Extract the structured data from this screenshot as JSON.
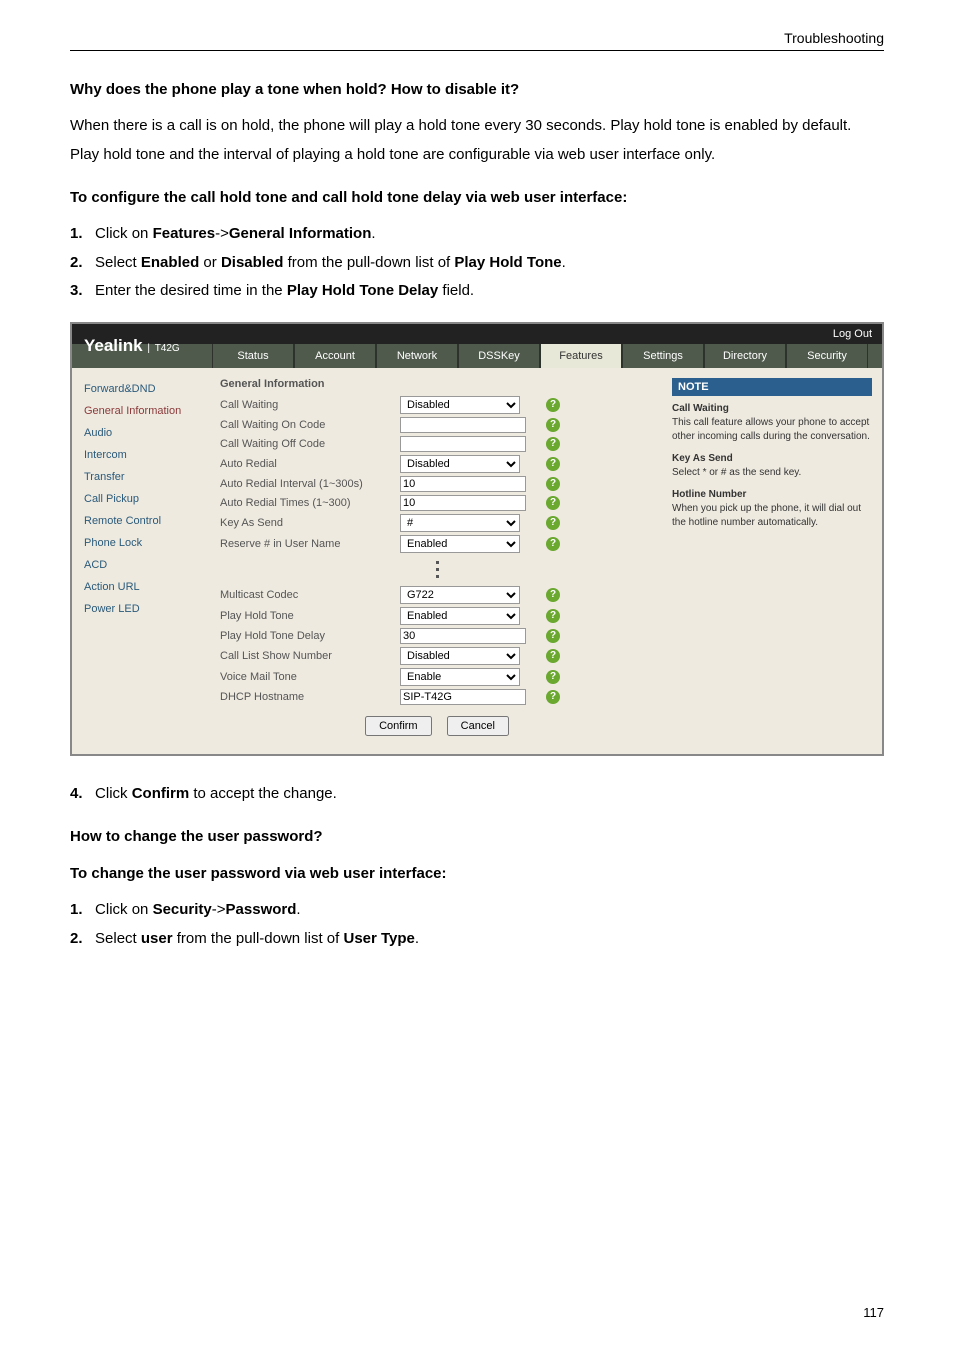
{
  "header_title": "Troubleshooting",
  "q1_heading": "Why does the phone play a tone when hold? How to disable it?",
  "q1_body": "When there is a call is on hold, the phone will play a hold tone every 30 seconds. Play hold tone is enabled by default. Play hold tone and the interval of playing a hold tone are configurable via web user interface only.",
  "q1_proc": "To configure the call hold tone and call hold tone delay via web user interface:",
  "q1_step1_num": "1.",
  "q1_step1_a": "Click on ",
  "q1_step1_b": "Features",
  "q1_step1_c": "->",
  "q1_step1_d": "General Information",
  "q1_step1_e": ".",
  "q1_step2_num": "2.",
  "q1_step2_a": "Select ",
  "q1_step2_b": "Enabled",
  "q1_step2_c": " or ",
  "q1_step2_d": "Disabled",
  "q1_step2_e": " from the pull-down list of ",
  "q1_step2_f": "Play Hold Tone",
  "q1_step2_g": ".",
  "q1_step3_num": "3.",
  "q1_step3_a": "Enter the desired time in the ",
  "q1_step3_b": "Play Hold Tone Delay",
  "q1_step3_c": " field.",
  "q1_step4_num": "4.",
  "q1_step4_a": "Click ",
  "q1_step4_b": "Confirm",
  "q1_step4_c": " to accept the change.",
  "q2_heading": "How to change the user password?",
  "q2_proc": "To change the user password via web user interface:",
  "q2_step1_num": "1.",
  "q2_step1_a": "Click on ",
  "q2_step1_b": "Security",
  "q2_step1_c": "->",
  "q2_step1_d": "Password",
  "q2_step1_e": ".",
  "q2_step2_num": "2.",
  "q2_step2_a": "Select ",
  "q2_step2_b": "user",
  "q2_step2_c": " from the pull-down list of ",
  "q2_step2_d": "User Type",
  "q2_step2_e": ".",
  "page_number": "117",
  "ss": {
    "logout": "Log Out",
    "brand": "Yealink",
    "model": "T42G",
    "tabs": [
      "Status",
      "Account",
      "Network",
      "DSSKey",
      "Features",
      "Settings",
      "Directory",
      "Security"
    ],
    "nav": [
      "Forward&DND",
      "General Information",
      "Audio",
      "Intercom",
      "Transfer",
      "Call Pickup",
      "Remote Control",
      "Phone Lock",
      "ACD",
      "Action URL",
      "Power LED"
    ],
    "nav_selected": 1,
    "section_title": "General Information",
    "rows_top": [
      {
        "label": "Call Waiting",
        "type": "select",
        "value": "Disabled"
      },
      {
        "label": "Call Waiting On Code",
        "type": "input",
        "value": ""
      },
      {
        "label": "Call Waiting Off Code",
        "type": "input",
        "value": ""
      },
      {
        "label": "Auto Redial",
        "type": "select",
        "value": "Disabled"
      },
      {
        "label": "Auto Redial Interval (1~300s)",
        "type": "input",
        "value": "10"
      },
      {
        "label": "Auto Redial Times (1~300)",
        "type": "input",
        "value": "10"
      },
      {
        "label": "Key As Send",
        "type": "select",
        "value": "#"
      },
      {
        "label": "Reserve # in User Name",
        "type": "select",
        "value": "Enabled"
      }
    ],
    "rows_bottom": [
      {
        "label": "Multicast Codec",
        "type": "select",
        "value": "G722"
      },
      {
        "label": "Play Hold Tone",
        "type": "select",
        "value": "Enabled"
      },
      {
        "label": "Play Hold Tone Delay",
        "type": "input",
        "value": "30"
      },
      {
        "label": "Call List Show Number",
        "type": "select",
        "value": "Disabled"
      },
      {
        "label": "Voice Mail Tone",
        "type": "select",
        "value": "Enable"
      },
      {
        "label": "DHCP Hostname",
        "type": "input",
        "value": "SIP-T42G"
      }
    ],
    "confirm": "Confirm",
    "cancel": "Cancel",
    "note_heading": "NOTE",
    "notes": [
      {
        "title": "Call Waiting",
        "body": "This call feature allows your phone to accept other incoming calls during the conversation."
      },
      {
        "title": "Key As Send",
        "body": "Select * or # as the send key."
      },
      {
        "title": "Hotline Number",
        "body": "When you pick up the phone, it will dial out the hotline number automatically."
      }
    ]
  }
}
